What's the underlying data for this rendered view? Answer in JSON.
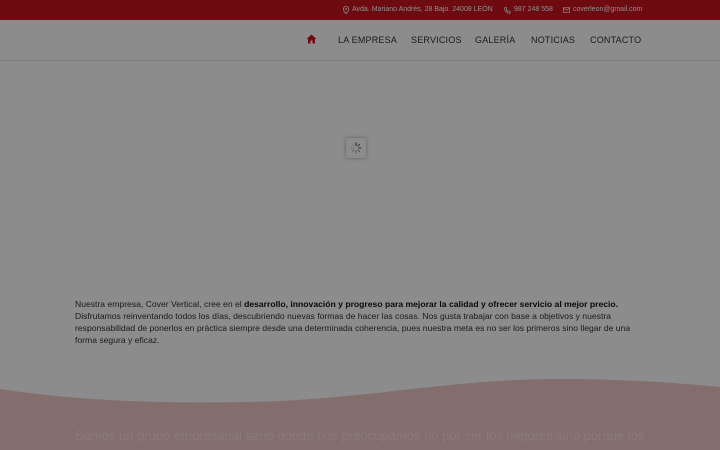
{
  "topbar": {
    "address": "Avda. Mariano Andrés, 28 Bajo. 24008 LEÓN",
    "phone": "987 248 558",
    "email": "coverleon@gmail.com"
  },
  "nav": {
    "home_icon": "home-icon",
    "items": [
      {
        "label": "LA EMPRESA"
      },
      {
        "label": "SERVICIOS"
      },
      {
        "label": "GALERÍA"
      },
      {
        "label": "NOTICIAS"
      },
      {
        "label": "CONTACTO"
      }
    ]
  },
  "intro": {
    "part1": "Nuestra empresa, Cover Vertical, cree en el ",
    "bold": "desarrollo, innovación y progreso para mejorar la calidad y ofrecer servicio al mejor precio.",
    "part2": " Disfrutamos reinventando todos los días, descubriendo nuevas formas de hacer las cosas. Nos gusta trabajar con base a objetivos y nuestra responsabilidad de ponerlos en práctica siempre desde una determinada coherencia, pues nuestra meta es no ser los primeros sino llegar de una forma segura y eficaz."
  },
  "band": {
    "text": "Somos un grupo empresarial serio donde nos preocupamos no por ser los mejores sino porque los"
  },
  "colors": {
    "brand_red": "#c8141f",
    "overlay": "rgba(0,0,0,0.45)"
  }
}
